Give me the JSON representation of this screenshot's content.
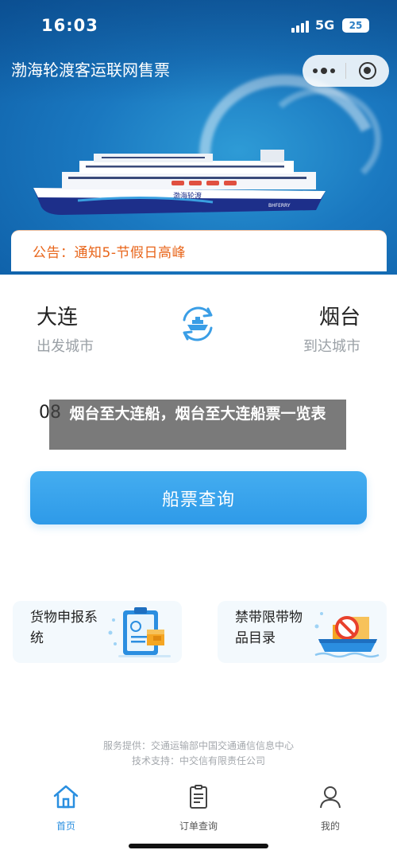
{
  "status_bar": {
    "time": "16:03",
    "network": "5G",
    "battery": "25"
  },
  "header": {
    "title": "渤海轮渡客运联网售票",
    "more_icon": "more-dots-icon",
    "close_icon": "target-circle-icon"
  },
  "banner": {
    "ship_name": "渤海轮渡",
    "ship_hull_text": "BHFERRY"
  },
  "notice": {
    "text": "公告：通知5-节假日高峰"
  },
  "route": {
    "from_city": "大连",
    "from_label": "出发城市",
    "to_city": "烟台",
    "to_label": "到达城市",
    "swap_icon": "ship-swap-icon"
  },
  "date": {
    "value": "08"
  },
  "overlay": {
    "text": "烟台至大连船，烟台至大连船票一览表"
  },
  "search": {
    "label": "船票查询"
  },
  "services": [
    {
      "label": "货物申报系统",
      "icon": "cargo-declaration-icon"
    },
    {
      "label": "禁带限带物品目录",
      "icon": "prohibited-items-icon"
    }
  ],
  "footer": {
    "provider": "服务提供：交通运输部中国交通通信信息中心",
    "support": "技术支持：中交信有限责任公司"
  },
  "tabs": [
    {
      "label": "首页",
      "icon": "home-icon",
      "active": true
    },
    {
      "label": "订单查询",
      "icon": "order-list-icon",
      "active": false
    },
    {
      "label": "我的",
      "icon": "user-icon",
      "active": false
    }
  ],
  "colors": {
    "accent": "#2a8fe0",
    "notice": "#e8651a",
    "banner": "#1a78c0"
  }
}
